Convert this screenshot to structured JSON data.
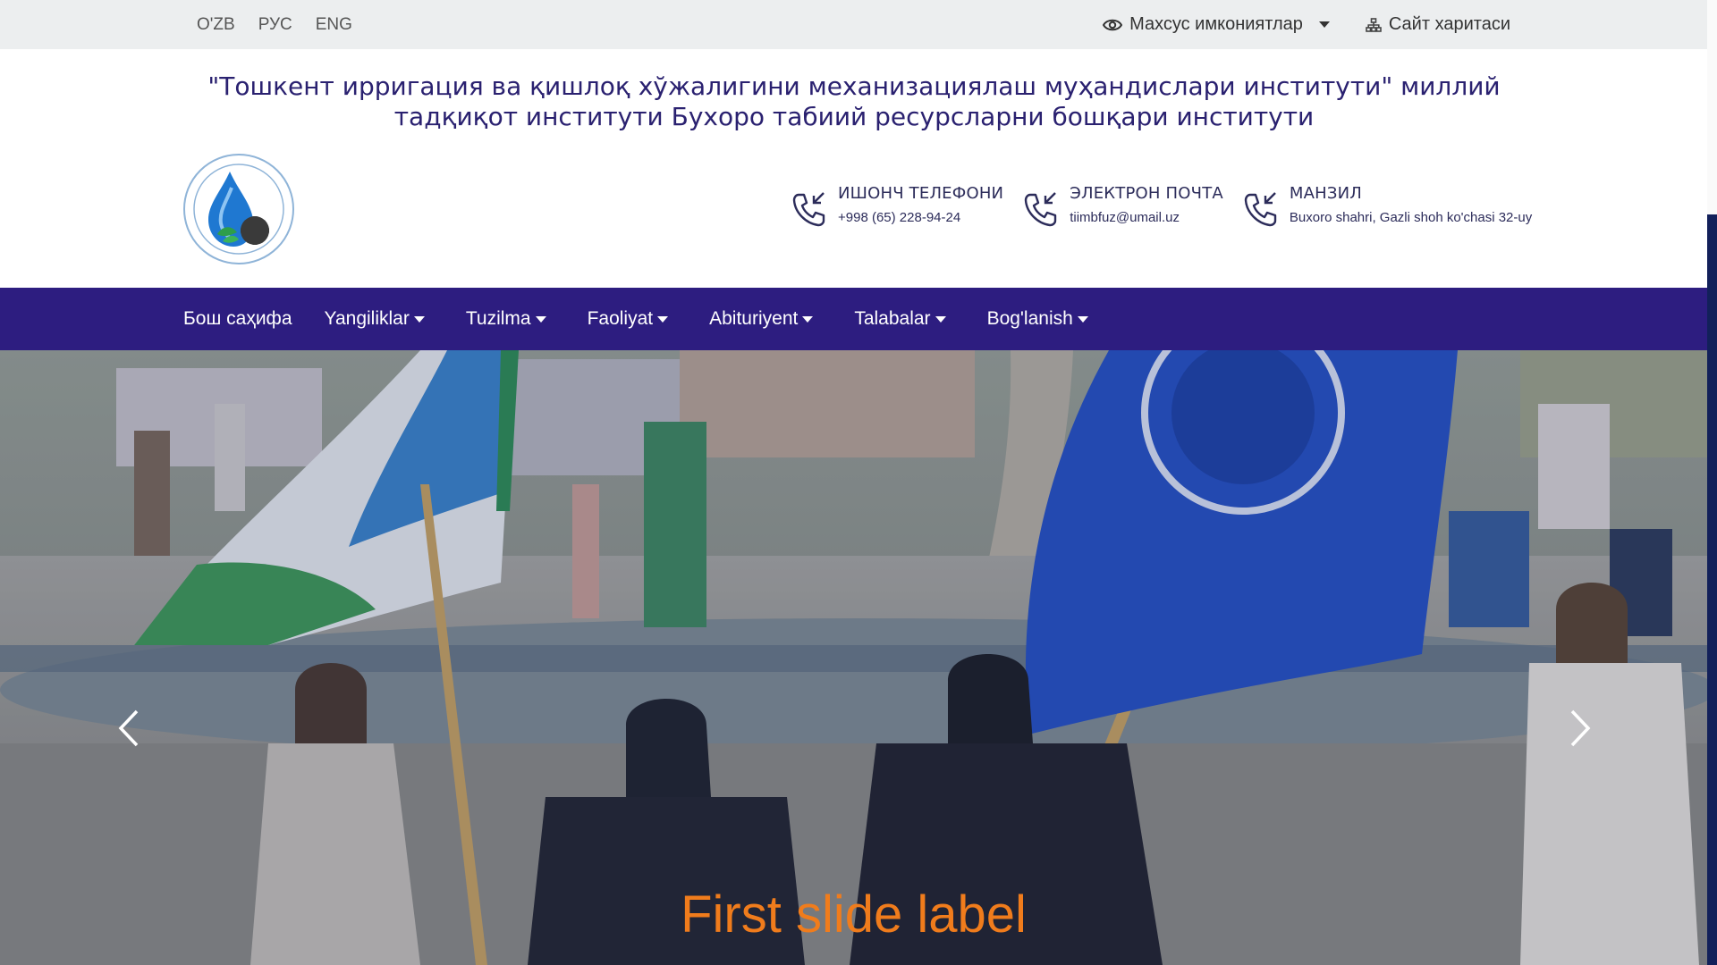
{
  "languages": [
    "O'ZB",
    "РУС",
    "ENG"
  ],
  "utility": {
    "accessibility_label": "Махсус имкониятлар",
    "sitemap_label": "Сайт харитаси"
  },
  "header": {
    "title_line1": "\"Тошкент ирригация ва қишлоқ хўжалигини механизациялаш муҳандислари институти\" миллий",
    "title_line2": "тадқиқот институти Бухоро табиий ресурсларни бошқари институти"
  },
  "contacts": [
    {
      "title": "ИШОНЧ ТЕЛЕФОНИ",
      "value": "+998 (65) 228-94-24"
    },
    {
      "title": "ЭЛЕКТРОН ПОЧТА",
      "value": "tiimbfuz@umail.uz"
    },
    {
      "title": "МАНЗИЛ",
      "value": "Buxoro shahri, Gazli shoh ko'chasi 32-uy"
    }
  ],
  "nav": [
    {
      "label": "Бош саҳифа",
      "dropdown": false
    },
    {
      "label": "Yangiliklar",
      "dropdown": true
    },
    {
      "label": "Tuzilma",
      "dropdown": true
    },
    {
      "label": "Faoliyat",
      "dropdown": true
    },
    {
      "label": "Abituriyent",
      "dropdown": true
    },
    {
      "label": "Talabalar",
      "dropdown": true
    },
    {
      "label": "Bog'lanish",
      "dropdown": true
    }
  ],
  "hero": {
    "caption": "First slide label"
  },
  "colors": {
    "nav_bg": "#2d1d80",
    "title": "#2a2170",
    "caption": "#f07c1c",
    "topbar_bg": "#eceeef"
  }
}
